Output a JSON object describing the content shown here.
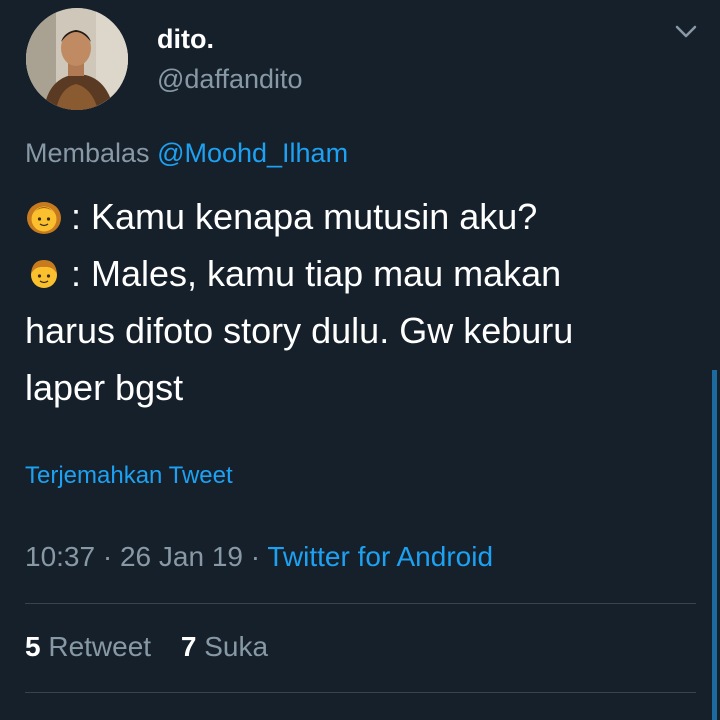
{
  "author": {
    "display_name": "dito.",
    "handle": "@daffandito",
    "avatar_icon": "user-avatar-photo"
  },
  "reply": {
    "prefix": "Membalas",
    "mention": "@Moohd_Ilham"
  },
  "tweet": {
    "line1_emoji": "girl-emoji",
    "line1_text": ": Kamu kenapa mutusin aku?",
    "line2_emoji": "boy-emoji",
    "line2_text": ": Males, kamu tiap mau makan",
    "line3_text": "harus difoto story dulu. Gw keburu",
    "line4_text": "laper bgst"
  },
  "translate_label": "Terjemahkan Tweet",
  "meta": {
    "time": "10:37",
    "date": "26 Jan 19",
    "separator": "·",
    "source": "Twitter for Android"
  },
  "stats": {
    "retweets_count": "5",
    "retweets_label": "Retweet",
    "likes_count": "7",
    "likes_label": "Suka"
  },
  "colors": {
    "background": "#15202b",
    "accent": "#1da1f2",
    "secondary_text": "#8899a6",
    "divider": "#38444d"
  }
}
